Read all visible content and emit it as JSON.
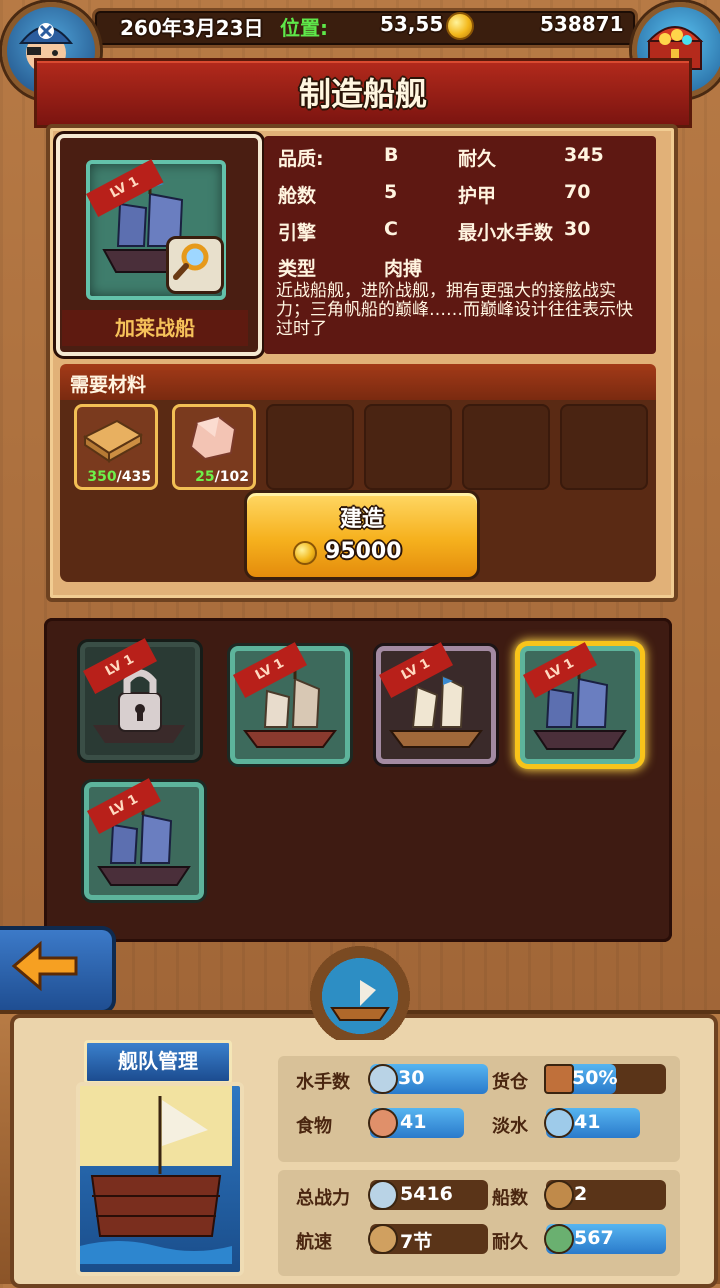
{
  "topbar": {
    "date": "260年3月23日",
    "location_label": "位置:",
    "location_value": "53,55",
    "gold": "538871"
  },
  "title": "制造船舰",
  "ship": {
    "name": "加莱战船",
    "level_badge": "LV 1",
    "stats": [
      {
        "label": "品质:",
        "value": "B"
      },
      {
        "label": "耐久",
        "value": "345"
      },
      {
        "label": "舱数",
        "value": "5"
      },
      {
        "label": "护甲",
        "value": "70"
      },
      {
        "label": "引擎",
        "value": "C"
      },
      {
        "label": "最小水手数",
        "value": "30"
      },
      {
        "label": "类型",
        "value": "肉搏"
      }
    ],
    "description": "近战船舰，进阶战舰，拥有更强大的接舷战实力；三角帆船的巅峰……而巅峰设计往往表示快过时了"
  },
  "materials": {
    "header": "需要材料",
    "items": [
      {
        "icon": "wood-planks-icon",
        "have": "350",
        "need": "/435"
      },
      {
        "icon": "stone-icon",
        "have": "25",
        "need": "/102"
      }
    ]
  },
  "build": {
    "label": "建造",
    "cost": "95000"
  },
  "ship_list": [
    {
      "level": "LV 1",
      "state": "locked"
    },
    {
      "level": "LV 1",
      "state": "available"
    },
    {
      "level": "LV 1",
      "state": "available"
    },
    {
      "level": "LV 1",
      "state": "selected"
    },
    {
      "level": "LV 1",
      "state": "available"
    }
  ],
  "fleet": {
    "title": "舰队管理",
    "stats_a": [
      {
        "label": "水手数",
        "value": "30",
        "icon": "sailor-icon"
      },
      {
        "label": "货仓",
        "value": "50%",
        "icon": "crate-icon"
      },
      {
        "label": "食物",
        "value": "41",
        "icon": "meat-icon"
      },
      {
        "label": "淡水",
        "value": "41",
        "icon": "water-jug-icon"
      }
    ],
    "stats_b": [
      {
        "label": "总战力",
        "value": "5416",
        "icon": "crossed-swords-icon"
      },
      {
        "label": "船数",
        "value": "2",
        "icon": "ship-count-icon"
      },
      {
        "label": "航速",
        "value": "7节",
        "icon": "sail-icon"
      },
      {
        "label": "耐久",
        "value": "567",
        "icon": "anchor-icon"
      }
    ]
  },
  "colors": {
    "title_red": "#b32a1c",
    "gold_button": "#f6b11e",
    "fleet_blue": "#2a7acb"
  }
}
